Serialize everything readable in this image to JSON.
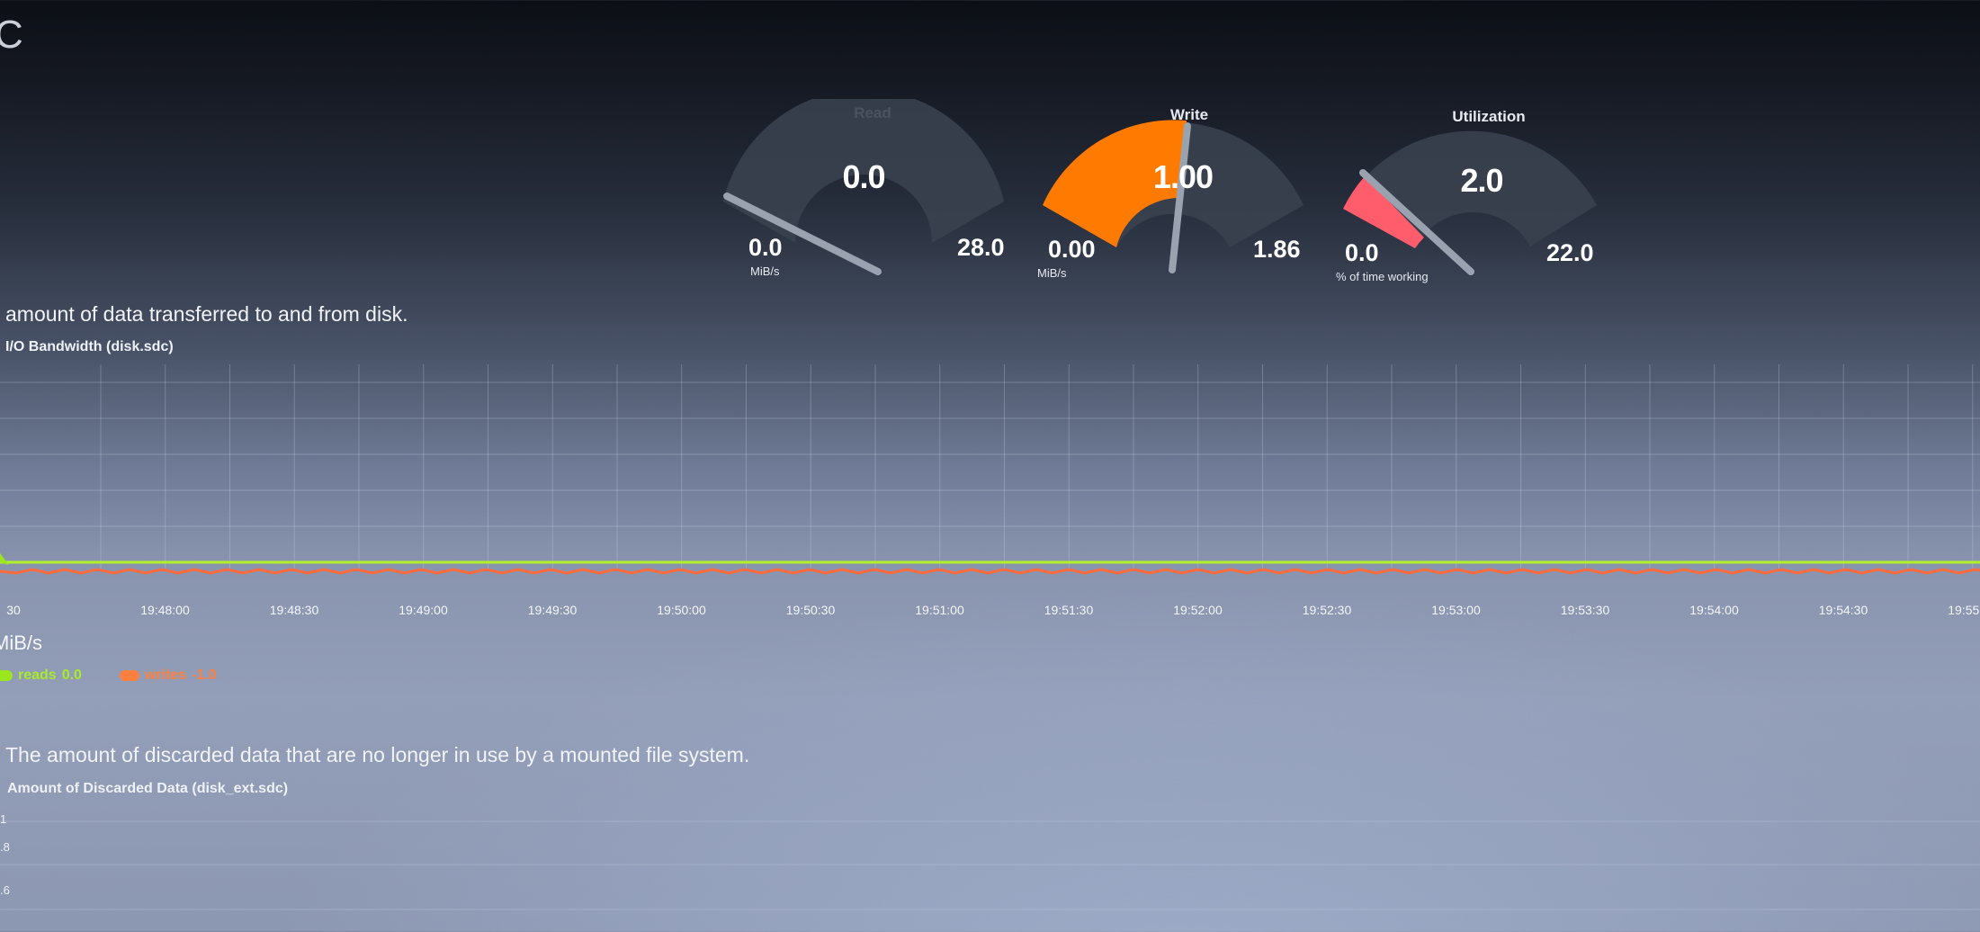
{
  "page": {
    "title_fragment": "C"
  },
  "gauges": [
    {
      "title": "Read",
      "value": "0.0",
      "min": "0.0",
      "max": "28.0",
      "unit": "MiB/s",
      "fraction": 0.0,
      "color": "#ff7f0e"
    },
    {
      "title": "Write",
      "value": "1.00",
      "min": "0.00",
      "max": "1.86",
      "unit": "MiB/s",
      "fraction": 0.54,
      "color": "#ff7f0e"
    },
    {
      "title": "Utilization",
      "value": "2.0",
      "min": "0.0",
      "max": "22.0",
      "unit": "% of time working",
      "fraction": 0.09,
      "color": "#ff5c6c"
    }
  ],
  "io_section": {
    "description": "amount of data transferred to and from disk.",
    "chart_title": "I/O Bandwidth (disk.sdc)",
    "unit": "MiB/s",
    "x_ticks": [
      "30",
      "19:48:00",
      "19:48:30",
      "19:49:00",
      "19:49:30",
      "19:50:00",
      "19:50:30",
      "19:51:00",
      "19:51:30",
      "19:52:00",
      "19:52:30",
      "19:53:00",
      "19:53:30",
      "19:54:00",
      "19:54:30",
      "19:55:00"
    ],
    "legend": [
      {
        "name": "reads",
        "value": "0.0",
        "color": "#9be61c"
      },
      {
        "name": "writes",
        "value": "-1.0",
        "color": "#ff7f3f"
      }
    ]
  },
  "chart_data": {
    "type": "line",
    "title": "I/O Bandwidth (disk.sdc)",
    "ylabel": "MiB/s",
    "x": [
      "30",
      "19:48:00",
      "19:48:30",
      "19:49:00",
      "19:49:30",
      "19:50:00",
      "19:50:30",
      "19:51:00",
      "19:51:30",
      "19:52:00",
      "19:52:30",
      "19:53:00",
      "19:53:30",
      "19:54:00",
      "19:54:30",
      "19:55:00"
    ],
    "series": [
      {
        "name": "reads",
        "values": [
          0,
          0,
          0,
          0,
          0,
          0,
          0,
          0,
          0,
          0,
          0,
          0,
          0,
          0,
          0,
          0
        ]
      },
      {
        "name": "writes",
        "values": [
          -1,
          -1,
          -1,
          -1,
          -1,
          -1,
          -1,
          -1,
          -1,
          -1,
          -1,
          -1,
          -1,
          -1,
          -1,
          -1
        ]
      }
    ],
    "grid": true
  },
  "discard_section": {
    "description": "The amount of discarded data that are no longer in use by a mounted file system.",
    "chart_title": "Amount of Discarded Data (disk_ext.sdc)",
    "y_ticks": [
      "1",
      ".8",
      ".6"
    ]
  }
}
